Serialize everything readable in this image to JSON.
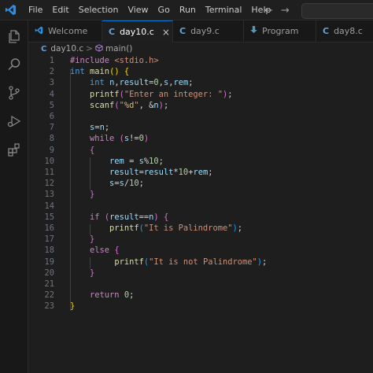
{
  "menu": [
    "File",
    "Edit",
    "Selection",
    "View",
    "Go",
    "Run",
    "Terminal",
    "Help"
  ],
  "nav": {
    "back": "←",
    "forward": "→"
  },
  "tabs": [
    {
      "label": "Welcome",
      "icon": "vscode-logo-icon",
      "active": false
    },
    {
      "label": "day10.c",
      "icon": "C",
      "active": true,
      "close": "×"
    },
    {
      "label": "day9.c",
      "icon": "C",
      "active": false
    },
    {
      "label": "Program",
      "icon": "download-arrow-icon",
      "active": false
    },
    {
      "label": "day8.c",
      "icon": "C",
      "active": false
    }
  ],
  "breadcrumb": {
    "file_icon": "C",
    "file": "day10.c",
    "separator": ">",
    "symbol": "main()"
  },
  "code": [
    {
      "n": "1",
      "tokens": [
        [
          "inc",
          "#include "
        ],
        [
          "hdr",
          "<stdio.h>"
        ]
      ]
    },
    {
      "n": "2",
      "tokens": [
        [
          "kw",
          "int "
        ],
        [
          "fn",
          "main"
        ],
        [
          "br1",
          "() {"
        ]
      ]
    },
    {
      "n": "3",
      "tokens": [
        [
          "op",
          "    "
        ],
        [
          "kw",
          "int "
        ],
        [
          "var",
          "n"
        ],
        [
          "op",
          ","
        ],
        [
          "var",
          "result"
        ],
        [
          "op",
          "="
        ],
        [
          "num",
          "0"
        ],
        [
          "op",
          ","
        ],
        [
          "var",
          "s"
        ],
        [
          "op",
          ","
        ],
        [
          "var",
          "rem"
        ],
        [
          "op",
          ";"
        ]
      ]
    },
    {
      "n": "4",
      "tokens": [
        [
          "op",
          "    "
        ],
        [
          "fn",
          "printf"
        ],
        [
          "br2",
          "("
        ],
        [
          "str",
          "\"Enter an integer: \""
        ],
        [
          "br2",
          ")"
        ],
        [
          "op",
          ";"
        ]
      ]
    },
    {
      "n": "5",
      "tokens": [
        [
          "op",
          "    "
        ],
        [
          "fn",
          "scanf"
        ],
        [
          "br2",
          "("
        ],
        [
          "str",
          "\""
        ],
        [
          "esc",
          "%d"
        ],
        [
          "str",
          "\""
        ],
        [
          "op",
          ", &"
        ],
        [
          "var",
          "n"
        ],
        [
          "br2",
          ")"
        ],
        [
          "op",
          ";"
        ]
      ]
    },
    {
      "n": "6",
      "tokens": []
    },
    {
      "n": "7",
      "tokens": [
        [
          "op",
          "    "
        ],
        [
          "var",
          "s"
        ],
        [
          "op",
          "="
        ],
        [
          "var",
          "n"
        ],
        [
          "op",
          ";"
        ]
      ]
    },
    {
      "n": "8",
      "tokens": [
        [
          "op",
          "    "
        ],
        [
          "ctl",
          "while "
        ],
        [
          "br2",
          "("
        ],
        [
          "var",
          "s"
        ],
        [
          "op",
          "!="
        ],
        [
          "num",
          "0"
        ],
        [
          "br2",
          ")"
        ]
      ]
    },
    {
      "n": "9",
      "tokens": [
        [
          "op",
          "    "
        ],
        [
          "br2",
          "{"
        ]
      ]
    },
    {
      "n": "10",
      "tokens": [
        [
          "op",
          "        "
        ],
        [
          "var",
          "rem "
        ],
        [
          "op",
          "= "
        ],
        [
          "var",
          "s"
        ],
        [
          "op",
          "%"
        ],
        [
          "num",
          "10"
        ],
        [
          "op",
          ";"
        ]
      ]
    },
    {
      "n": "11",
      "tokens": [
        [
          "op",
          "        "
        ],
        [
          "var",
          "result"
        ],
        [
          "op",
          "="
        ],
        [
          "var",
          "result"
        ],
        [
          "op",
          "*"
        ],
        [
          "num",
          "10"
        ],
        [
          "op",
          "+"
        ],
        [
          "var",
          "rem"
        ],
        [
          "op",
          ";"
        ]
      ]
    },
    {
      "n": "12",
      "tokens": [
        [
          "op",
          "        "
        ],
        [
          "var",
          "s"
        ],
        [
          "op",
          "="
        ],
        [
          "var",
          "s"
        ],
        [
          "op",
          "/"
        ],
        [
          "num",
          "10"
        ],
        [
          "op",
          ";"
        ]
      ]
    },
    {
      "n": "13",
      "tokens": [
        [
          "op",
          "    "
        ],
        [
          "br2",
          "}"
        ]
      ]
    },
    {
      "n": "14",
      "tokens": []
    },
    {
      "n": "15",
      "tokens": [
        [
          "op",
          "    "
        ],
        [
          "ctl",
          "if "
        ],
        [
          "br2",
          "("
        ],
        [
          "var",
          "result"
        ],
        [
          "op",
          "=="
        ],
        [
          "var",
          "n"
        ],
        [
          "br2",
          ")"
        ],
        [
          "op",
          " "
        ],
        [
          "br2",
          "{"
        ]
      ]
    },
    {
      "n": "16",
      "tokens": [
        [
          "op",
          "        "
        ],
        [
          "fn",
          "printf"
        ],
        [
          "br3",
          "("
        ],
        [
          "str",
          "\"It is Palindrome\""
        ],
        [
          "br3",
          ")"
        ],
        [
          "op",
          ";"
        ]
      ]
    },
    {
      "n": "17",
      "tokens": [
        [
          "op",
          "    "
        ],
        [
          "br2",
          "}"
        ]
      ]
    },
    {
      "n": "18",
      "tokens": [
        [
          "op",
          "    "
        ],
        [
          "ctl",
          "else "
        ],
        [
          "br2",
          "{"
        ]
      ]
    },
    {
      "n": "19",
      "tokens": [
        [
          "op",
          "         "
        ],
        [
          "fn",
          "printf"
        ],
        [
          "br3",
          "("
        ],
        [
          "str",
          "\"It is not Palindrome\""
        ],
        [
          "br3",
          ")"
        ],
        [
          "op",
          ";"
        ]
      ]
    },
    {
      "n": "20",
      "tokens": [
        [
          "op",
          "    "
        ],
        [
          "br2",
          "}"
        ]
      ]
    },
    {
      "n": "21",
      "tokens": []
    },
    {
      "n": "22",
      "tokens": [
        [
          "op",
          "    "
        ],
        [
          "ctl",
          "return "
        ],
        [
          "num",
          "0"
        ],
        [
          "op",
          ";"
        ]
      ]
    },
    {
      "n": "23",
      "tokens": [
        [
          "br1",
          "}"
        ]
      ]
    }
  ],
  "colors": {
    "accent": "#0078d4",
    "background": "#1e1e1e"
  }
}
